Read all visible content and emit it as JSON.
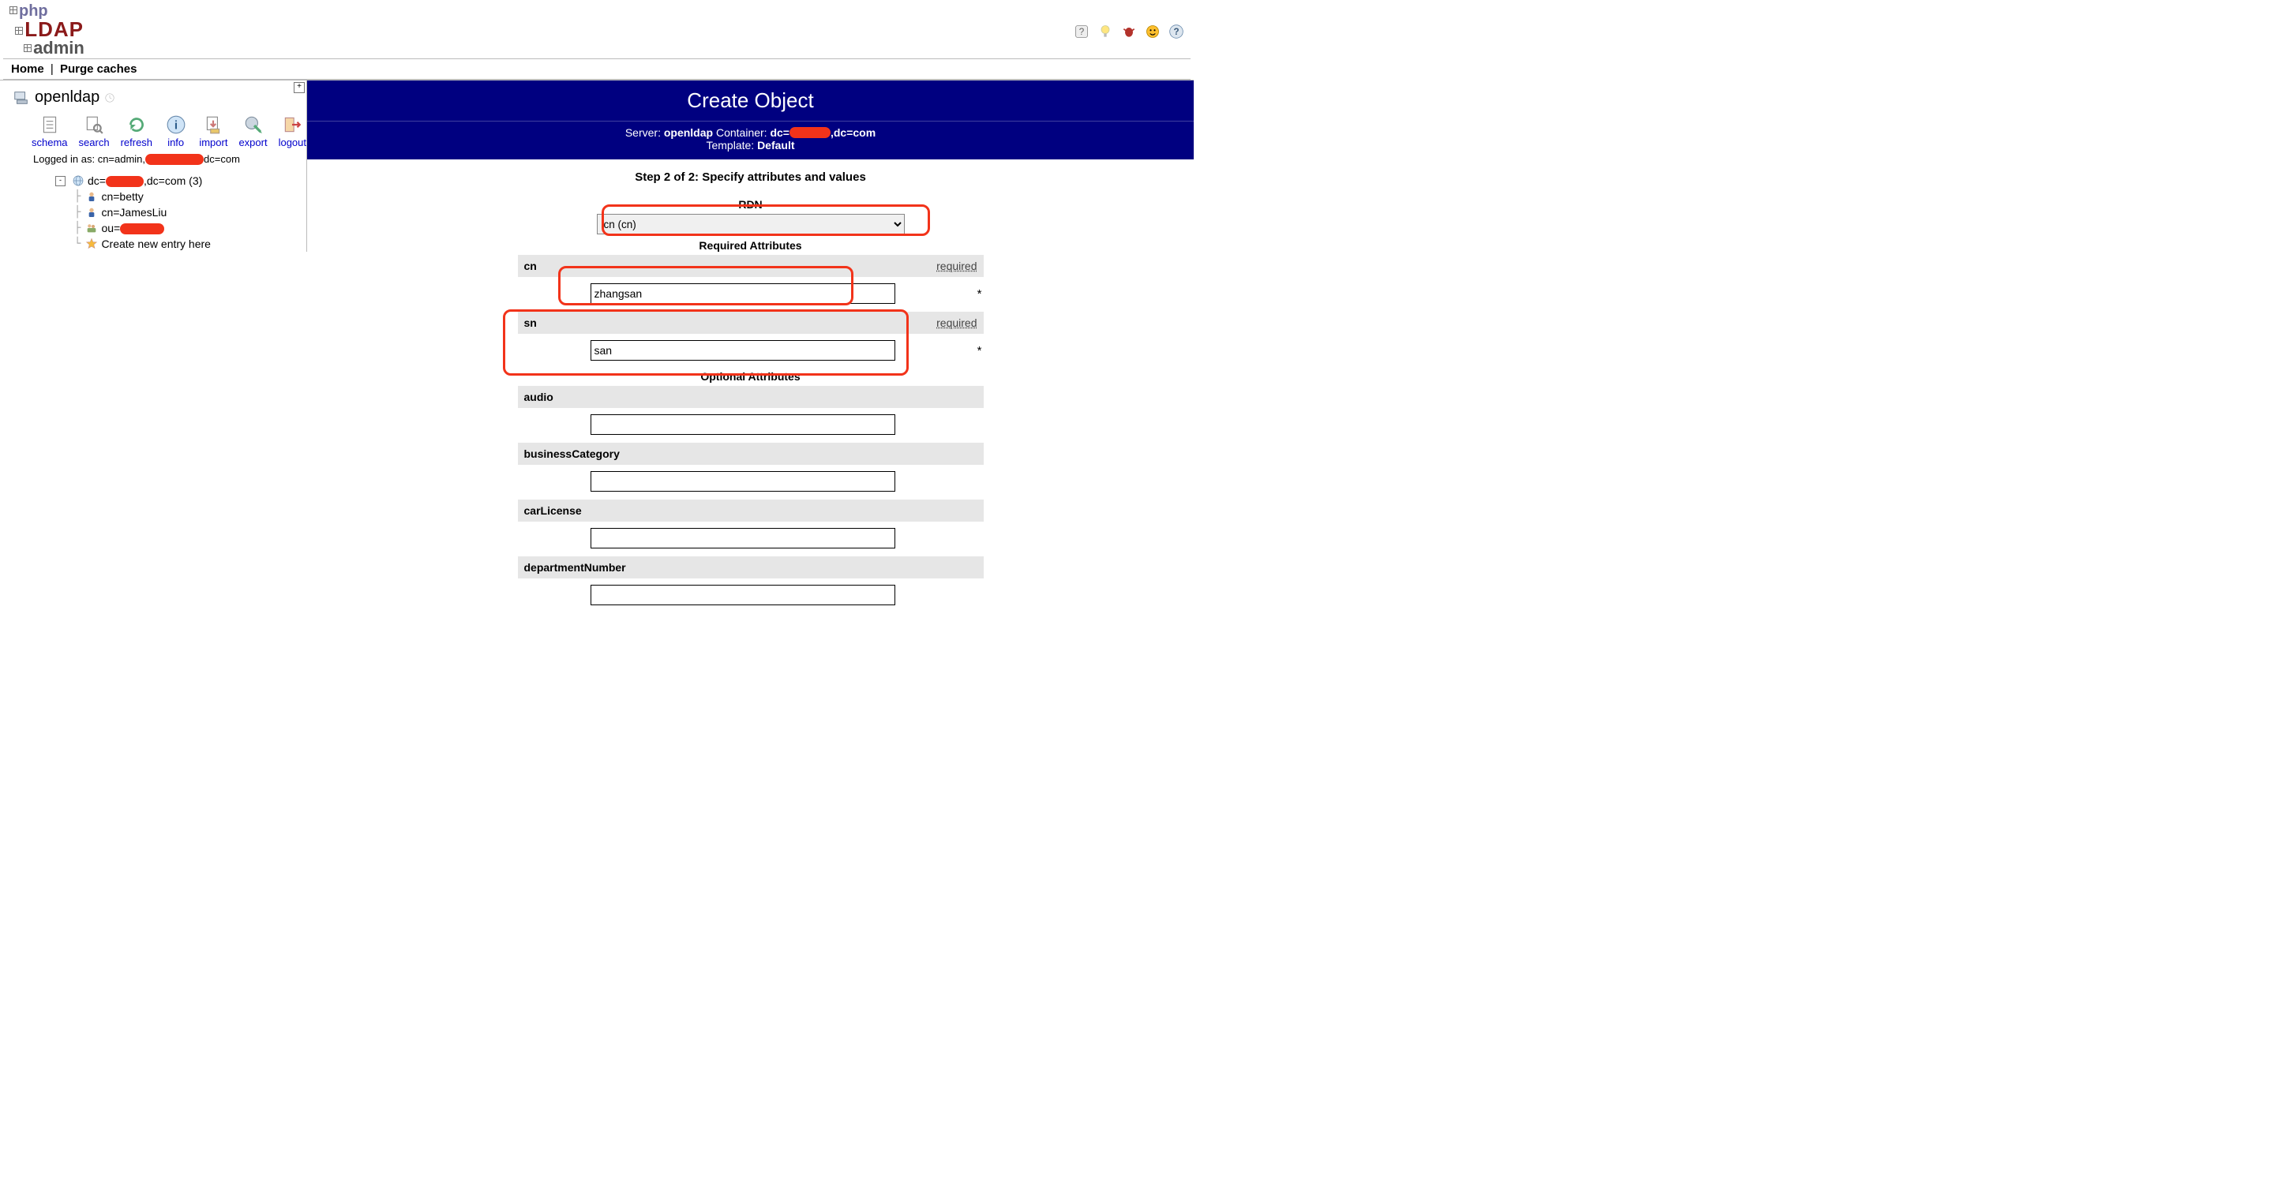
{
  "brand": {
    "p1": "php",
    "p2": "LDAP",
    "p3": "admin"
  },
  "nav": {
    "home": "Home",
    "purge": "Purge caches",
    "sep": " | "
  },
  "server": {
    "name": "openldap"
  },
  "actions": {
    "schema": "schema",
    "search": "search",
    "refresh": "refresh",
    "info": "info",
    "import": "import",
    "export": "export",
    "logout": "logout"
  },
  "logged": {
    "prefix": "Logged in as: ",
    "before": "cn=admin,",
    "after": "dc=com"
  },
  "tree": {
    "root_before": "dc=",
    "root_after": ",dc=com (3)",
    "n1_before": "cn=",
    "n1_after": "betty",
    "n2_before": "cn=",
    "n2_after": "JamesLiu",
    "n3_before": "ou=",
    "create": "Create new entry here"
  },
  "title": "Create Object",
  "sub": {
    "server_lbl": "Server: ",
    "server_val": "openldap",
    "container_lbl": "   Container: ",
    "container_before": "dc=",
    "container_after": ",dc=com",
    "template_lbl": "Template: ",
    "template_val": "Default"
  },
  "step": "Step 2 of 2: Specify attributes and values",
  "rdn": {
    "label": "RDN",
    "selected": "cn (cn)"
  },
  "sections": {
    "required": "Required Attributes",
    "optional": "Optional Attributes"
  },
  "required_tag": "required",
  "attrs": {
    "cn": {
      "name": "cn",
      "value": "zhangsan"
    },
    "sn": {
      "name": "sn",
      "value": "san"
    },
    "audio": {
      "name": "audio",
      "value": ""
    },
    "businessCategory": {
      "name": "businessCategory",
      "value": ""
    },
    "carLicense": {
      "name": "carLicense",
      "value": ""
    },
    "departmentNumber": {
      "name": "departmentNumber",
      "value": ""
    }
  },
  "star": "*"
}
